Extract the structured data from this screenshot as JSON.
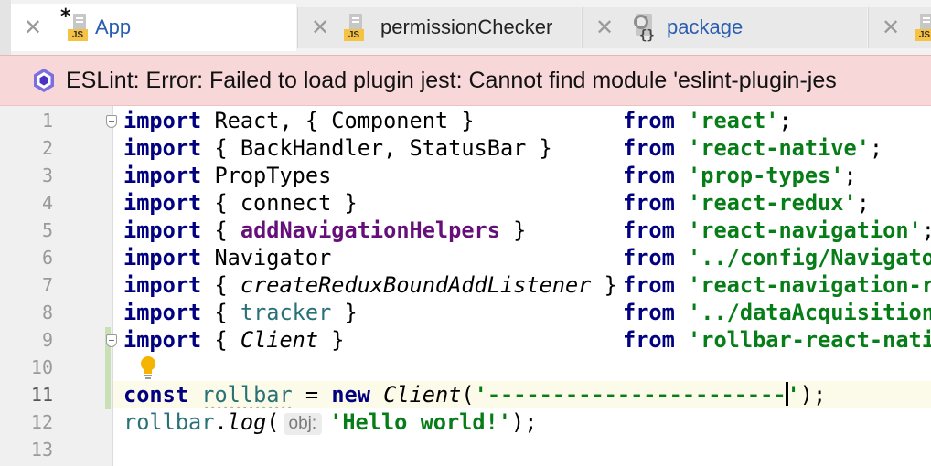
{
  "tabs": [
    {
      "label": "App",
      "modified_marker": "*",
      "icon": "js-file-icon",
      "badge": "JS",
      "active": true
    },
    {
      "label": "permissionChecker",
      "icon": "js-file-icon",
      "badge": "JS",
      "active": false
    },
    {
      "label": "package",
      "icon": "package-json-icon",
      "badge": "{}",
      "active": false
    },
    {
      "label": "",
      "icon": "js-file-icon",
      "badge": "JS",
      "active": false
    }
  ],
  "tab_close_glyph": "✕",
  "banner": {
    "message": "ESLint: Error: Failed to load plugin jest: Cannot find module 'eslint-plugin-jes",
    "icon": "eslint-icon",
    "color": "#f8d7d8"
  },
  "editor": {
    "line_numbers": [
      "1",
      "2",
      "3",
      "4",
      "5",
      "6",
      "7",
      "8",
      "9",
      "10",
      "11",
      "12",
      "13"
    ],
    "current_line": 11,
    "code": {
      "l1": {
        "kw": "import",
        "body": " React, { Component } ",
        "from": "from",
        "str": "'react'",
        "end": ";"
      },
      "l2": {
        "kw": "import",
        "body": " { BackHandler, StatusBar } ",
        "from": "from",
        "str": "'react-native'",
        "end": ";"
      },
      "l3": {
        "kw": "import",
        "body": " PropTypes",
        "from": "from",
        "str": "'prop-types'",
        "end": ";"
      },
      "l4": {
        "kw": "import",
        "body": " { connect } ",
        "from": "from",
        "str": "'react-redux'",
        "end": ";"
      },
      "l5": {
        "kw": "import",
        "open": " { ",
        "name": "addNavigationHelpers",
        "close": " } ",
        "from": "from",
        "str": "'react-navigation'",
        "end": ";"
      },
      "l6": {
        "kw": "import",
        "body": " Navigator",
        "from": "from",
        "str": "'../config/Navigato"
      },
      "l7": {
        "kw": "import",
        "open": " { ",
        "name": "createReduxBoundAddListener",
        "close": " } ",
        "from": "from",
        "str": "'react-navigation-re"
      },
      "l8": {
        "kw": "import",
        "open": " { ",
        "name": "tracker",
        "close": " } ",
        "from": "from",
        "str": "'../dataAcquisition"
      },
      "l9": {
        "kw": "import",
        "open": " { ",
        "name": "Client",
        "close": " } ",
        "from": "from",
        "str": "'rollbar-react-nati"
      },
      "l11": {
        "kw": "const",
        "var": "rollbar",
        "eq": " = ",
        "new": "new",
        "cls": "Client",
        "open": "(",
        "str_a": "'-----------------------",
        "str_b": "'",
        "end": ");"
      },
      "l12": {
        "obj": "rollbar",
        "dot": ".",
        "method": "log",
        "open": "(",
        "hint": "obj:",
        "str": "'Hello world!'",
        "end": ");"
      }
    }
  },
  "colors": {
    "keyword": "#000080",
    "string": "#067d17",
    "function": "#660e7a",
    "current_line_bg": "#fcfae9",
    "active_tab_text": "#2a5db0"
  }
}
